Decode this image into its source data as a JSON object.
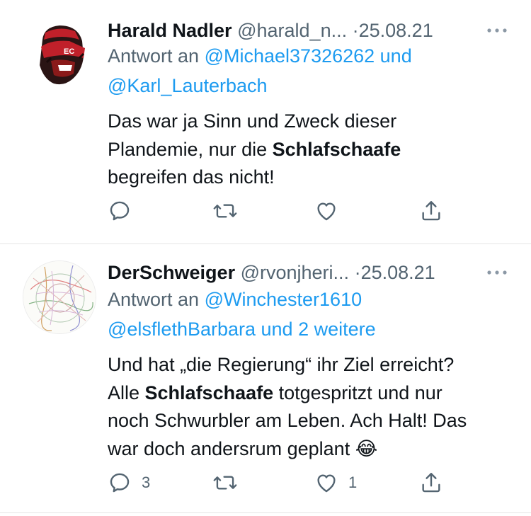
{
  "tweets": [
    {
      "display_name": "Harald Nadler",
      "handle": "@harald_n...",
      "separator": "·",
      "date": "25.08.21",
      "more_icon": "more-horizontal-icon",
      "reply_prefix": "Antwort an",
      "reply_line1_link": "@Michael37326262 und",
      "reply_line2_link": "@Karl_Lauterbach",
      "body": {
        "line1": "Das war ja Sinn und Zweck dieser",
        "line2_pre": "Plandemie, nur die ",
        "line2_bold": "Schlafschaafe",
        "line3": "begreifen das nicht!"
      },
      "actions": {
        "reply_count": "",
        "retweet_count": "",
        "like_count": ""
      }
    },
    {
      "display_name": "DerSchweiger",
      "handle": "@rvonjheri...",
      "separator": "·",
      "date": "25.08.21",
      "more_icon": "more-horizontal-icon",
      "reply_prefix": "Antwort an",
      "reply_line1_link": "@Winchester1610",
      "reply_line2_link": "@elsflethBarbara und 2 weitere",
      "body": {
        "line1": "Und hat „die Regierung“ ihr Ziel erreicht?",
        "line2_pre": "Alle ",
        "line2_bold": "Schlafschaafe",
        "line2_post": " totgespritzt und nur",
        "line3": "noch Schwurbler am Leben. Ach Halt! Das",
        "line4": "war doch andersrum geplant",
        "emoji": "😂"
      },
      "actions": {
        "reply_count": "3",
        "retweet_count": "",
        "like_count": "1"
      }
    }
  ],
  "colors": {
    "text": "#0f1419",
    "secondary": "#536471",
    "link": "#1d9bf0",
    "divider": "#e6e6e6"
  }
}
